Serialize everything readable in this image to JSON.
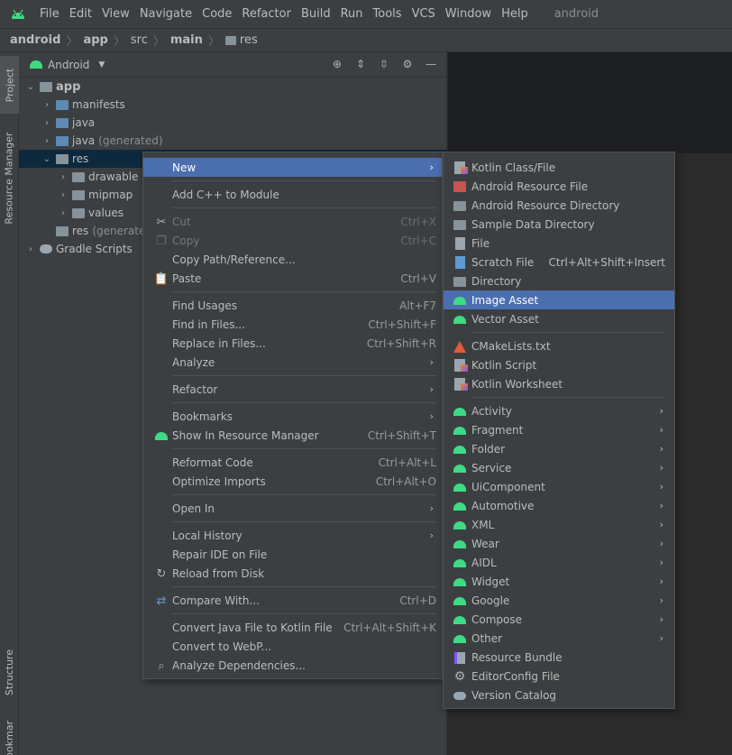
{
  "menubar": {
    "items": [
      "File",
      "Edit",
      "View",
      "Navigate",
      "Code",
      "Refactor",
      "Build",
      "Run",
      "Tools",
      "VCS",
      "Window",
      "Help"
    ],
    "project_name": "android"
  },
  "breadcrumb": [
    "android",
    "app",
    "src",
    "main",
    "res"
  ],
  "stripe": {
    "project": "Project",
    "resource_manager": "Resource Manager",
    "structure": "Structure",
    "bookmarks": "Bookmarks"
  },
  "panel": {
    "view_mode": "Android",
    "tree": [
      {
        "label": "app",
        "depth": 0,
        "expanded": true
      },
      {
        "label": "manifests",
        "depth": 1
      },
      {
        "label": "java",
        "depth": 1
      },
      {
        "label": "java",
        "suffix": "(generated)",
        "depth": 1
      },
      {
        "label": "res",
        "depth": 1,
        "expanded": true,
        "selected": true
      },
      {
        "label": "drawable",
        "depth": 2
      },
      {
        "label": "mipmap",
        "depth": 2
      },
      {
        "label": "values",
        "depth": 2
      },
      {
        "label": "res",
        "suffix": "(generated)",
        "depth": 1
      },
      {
        "label": "Gradle Scripts",
        "depth": 0
      }
    ]
  },
  "context_menu": {
    "new": "New",
    "add_cpp": "Add C++ to Module",
    "cut": "Cut",
    "cut_sc": "Ctrl+X",
    "copy": "Copy",
    "copy_sc": "Ctrl+C",
    "copy_path": "Copy Path/Reference...",
    "paste": "Paste",
    "paste_sc": "Ctrl+V",
    "find_usages": "Find Usages",
    "find_usages_sc": "Alt+F7",
    "find_in_files": "Find in Files...",
    "find_in_files_sc": "Ctrl+Shift+F",
    "replace_in_files": "Replace in Files...",
    "replace_in_files_sc": "Ctrl+Shift+R",
    "analyze": "Analyze",
    "refactor": "Refactor",
    "bookmarks": "Bookmarks",
    "show_in_rm": "Show In Resource Manager",
    "show_in_rm_sc": "Ctrl+Shift+T",
    "reformat": "Reformat Code",
    "reformat_sc": "Ctrl+Alt+L",
    "optimize": "Optimize Imports",
    "optimize_sc": "Ctrl+Alt+O",
    "open_in": "Open In",
    "local_history": "Local History",
    "repair_ide": "Repair IDE on File",
    "reload": "Reload from Disk",
    "compare": "Compare With...",
    "compare_sc": "Ctrl+D",
    "convert_kotlin": "Convert Java File to Kotlin File",
    "convert_kotlin_sc": "Ctrl+Alt+Shift+K",
    "convert_webp": "Convert to WebP...",
    "analyze_deps": "Analyze Dependencies..."
  },
  "submenu": {
    "kotlin_class": "Kotlin Class/File",
    "android_resource_file": "Android Resource File",
    "android_resource_dir": "Android Resource Directory",
    "sample_data_dir": "Sample Data Directory",
    "file": "File",
    "scratch_file": "Scratch File",
    "scratch_file_sc": "Ctrl+Alt+Shift+Insert",
    "directory": "Directory",
    "image_asset": "Image Asset",
    "vector_asset": "Vector Asset",
    "cmake": "CMakeLists.txt",
    "kotlin_script": "Kotlin Script",
    "kotlin_worksheet": "Kotlin Worksheet",
    "activity": "Activity",
    "fragment": "Fragment",
    "folder": "Folder",
    "service": "Service",
    "uicomponent": "UiComponent",
    "automotive": "Automotive",
    "xml": "XML",
    "wear": "Wear",
    "aidl": "AIDL",
    "widget": "Widget",
    "google": "Google",
    "compose": "Compose",
    "other": "Other",
    "resource_bundle": "Resource Bundle",
    "editorconfig": "EditorConfig File",
    "version_catalog": "Version Catalog"
  },
  "colors": {
    "highlight": "#4b6eaf",
    "android_green": "#3ddc84",
    "selection": "#0d293e"
  }
}
